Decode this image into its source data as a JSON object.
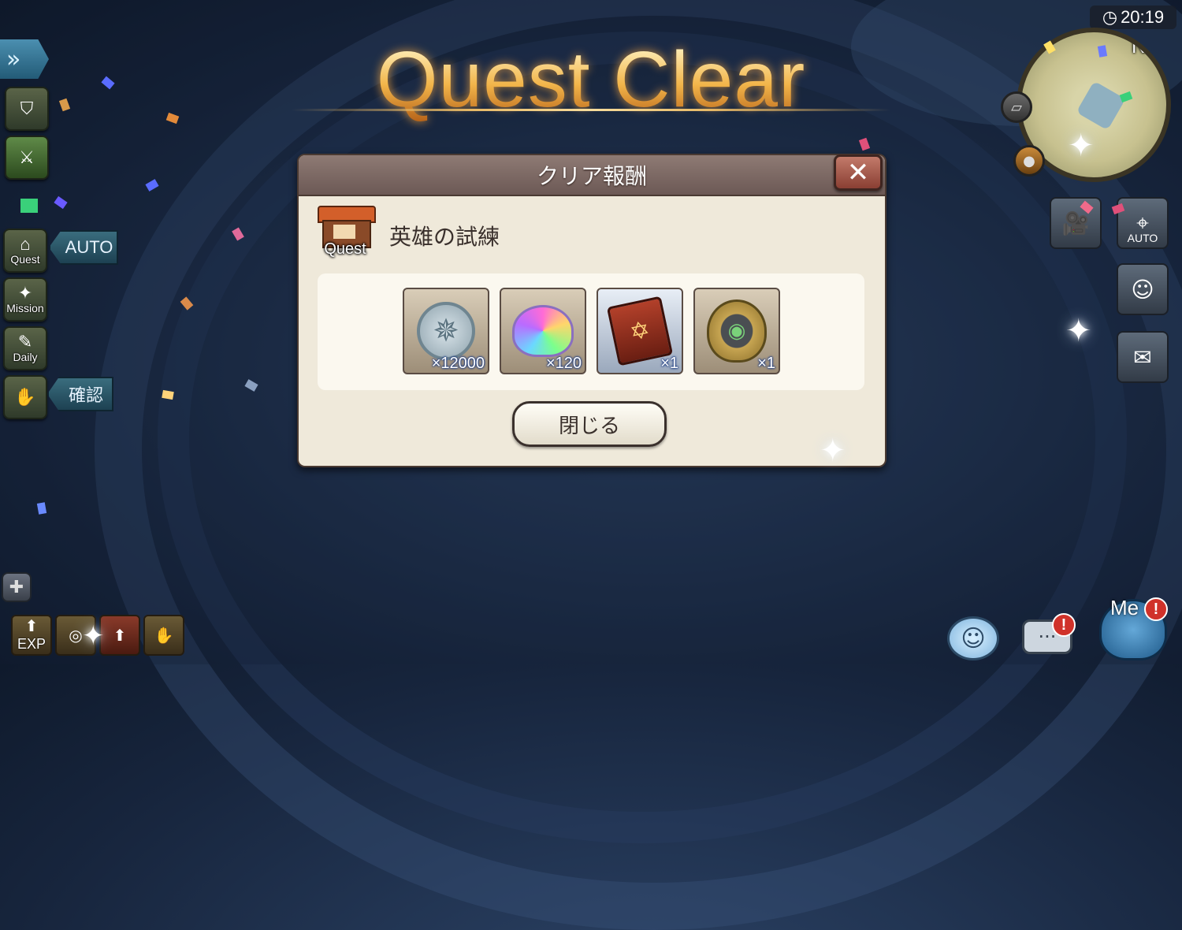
{
  "title": "Quest Clear",
  "dialog": {
    "header": "クリア報酬",
    "quest_icon_label": "Quest",
    "quest_name": "英雄の試練",
    "rewards": [
      {
        "name": "coin",
        "count": "×12000"
      },
      {
        "name": "rainbow-gem",
        "count": "×120"
      },
      {
        "name": "spell-book",
        "count": "×1"
      },
      {
        "name": "shield-emblem",
        "count": "×1"
      }
    ],
    "close_button": "閉じる"
  },
  "left_menu": {
    "quest_label": "Quest",
    "auto_tag": "AUTO",
    "mission_label": "Mission",
    "daily_label": "Daily",
    "confirm_tag": "確認"
  },
  "bottom_left": {
    "exp_label": "EXP"
  },
  "clock": "20:19",
  "minimap": {
    "north": "N"
  },
  "right_menu": {
    "auto_label": "AUTO"
  },
  "bottom_right": {
    "me_label": "Me",
    "alert_mark": "!"
  },
  "colors": {
    "title_gold": "#f2b54a",
    "dialog_bg": "#efe9da",
    "dialog_header": "#7d6a65",
    "close_x_bg": "#a5574a",
    "count_outline": "#1a3a80"
  }
}
